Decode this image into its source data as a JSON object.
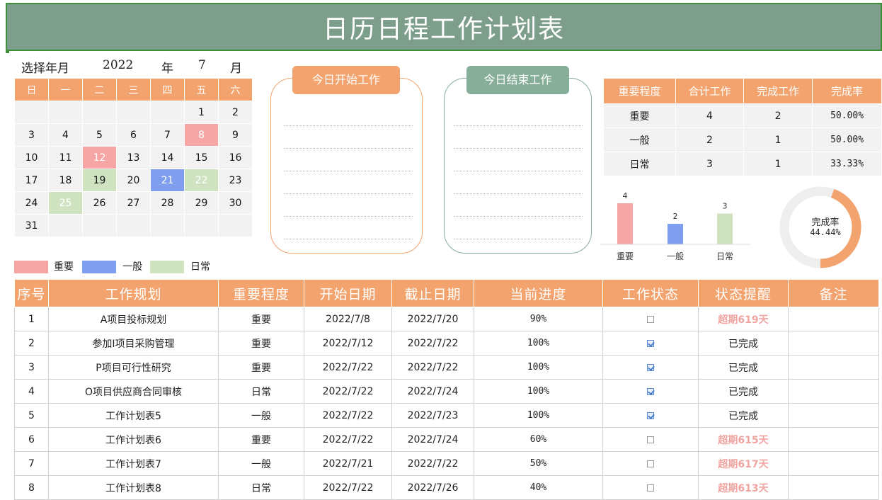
{
  "title": "日历日程工作计划表",
  "month_selector": {
    "label": "选择年月",
    "year": "2022",
    "year_unit": "年",
    "month": "7",
    "month_unit": "月"
  },
  "calendar": {
    "weekdays": [
      "日",
      "一",
      "二",
      "三",
      "四",
      "五",
      "六"
    ],
    "weeks": [
      [
        {
          "d": ""
        },
        {
          "d": ""
        },
        {
          "d": ""
        },
        {
          "d": ""
        },
        {
          "d": ""
        },
        {
          "d": "1"
        },
        {
          "d": "2"
        }
      ],
      [
        {
          "d": "3"
        },
        {
          "d": "4"
        },
        {
          "d": "5"
        },
        {
          "d": "6"
        },
        {
          "d": "7"
        },
        {
          "d": "8",
          "t": "imp"
        },
        {
          "d": "9"
        }
      ],
      [
        {
          "d": "10"
        },
        {
          "d": "11"
        },
        {
          "d": "12",
          "t": "imp"
        },
        {
          "d": "13"
        },
        {
          "d": "14"
        },
        {
          "d": "15"
        },
        {
          "d": "16"
        }
      ],
      [
        {
          "d": "17"
        },
        {
          "d": "18"
        },
        {
          "d": "19",
          "t": "day"
        },
        {
          "d": "20"
        },
        {
          "d": "21",
          "t": "gen"
        },
        {
          "d": "22",
          "t": "day light"
        },
        {
          "d": "23"
        }
      ],
      [
        {
          "d": "24"
        },
        {
          "d": "25",
          "t": "day light"
        },
        {
          "d": "26"
        },
        {
          "d": "27"
        },
        {
          "d": "28"
        },
        {
          "d": "29"
        },
        {
          "d": "30"
        }
      ],
      [
        {
          "d": "31"
        },
        {
          "d": ""
        },
        {
          "d": ""
        },
        {
          "d": ""
        },
        {
          "d": ""
        },
        {
          "d": ""
        },
        {
          "d": ""
        }
      ]
    ]
  },
  "legend": [
    {
      "label": "重要",
      "color": "#f7a6a6"
    },
    {
      "label": "一般",
      "color": "#7f9ef0"
    },
    {
      "label": "日常",
      "color": "#cfe3c0"
    }
  ],
  "panels": {
    "start": {
      "label": "今日开始工作",
      "color": "#f2a36e"
    },
    "end": {
      "label": "今日结束工作",
      "color": "#86ae99"
    }
  },
  "stats": {
    "headers": [
      "重要程度",
      "合计工作",
      "完成工作",
      "完成率"
    ],
    "rows": [
      [
        "重要",
        "4",
        "2",
        "50.00%"
      ],
      [
        "一般",
        "2",
        "1",
        "50.00%"
      ],
      [
        "日常",
        "3",
        "1",
        "33.33%"
      ]
    ]
  },
  "bar_chart": {
    "categories": [
      "重要",
      "一般",
      "日常"
    ],
    "values": [
      4,
      2,
      3
    ],
    "colors": [
      "#f7a6a6",
      "#7f9ef0",
      "#cfe3c0"
    ],
    "ymax": 4
  },
  "donut": {
    "label": "完成率",
    "value_text": "44.44%",
    "fraction": 0.4444,
    "color": "#f2a36e",
    "track": "#eeeeee"
  },
  "main_table": {
    "headers": [
      "序号",
      "工作规划",
      "重要程度",
      "开始日期",
      "截止日期",
      "当前进度",
      "工作状态",
      "状态提醒",
      "备注"
    ],
    "rows": [
      {
        "no": "1",
        "plan": "A项目投标规划",
        "level": "重要",
        "start": "2022/7/8",
        "end": "2022/7/20",
        "progress": "90%",
        "done": false,
        "status": "超期619天",
        "overdue": true,
        "note": ""
      },
      {
        "no": "2",
        "plan": "参加I项目采购管理",
        "level": "重要",
        "start": "2022/7/12",
        "end": "2022/7/22",
        "progress": "100%",
        "done": true,
        "status": "已完成",
        "overdue": false,
        "note": ""
      },
      {
        "no": "3",
        "plan": "P项目可行性研究",
        "level": "重要",
        "start": "2022/7/22",
        "end": "2022/7/22",
        "progress": "100%",
        "done": true,
        "status": "已完成",
        "overdue": false,
        "note": ""
      },
      {
        "no": "4",
        "plan": "O项目供应商合同审核",
        "level": "日常",
        "start": "2022/7/22",
        "end": "2022/7/24",
        "progress": "100%",
        "done": true,
        "status": "已完成",
        "overdue": false,
        "note": ""
      },
      {
        "no": "5",
        "plan": "工作计划表5",
        "level": "一般",
        "start": "2022/7/22",
        "end": "2022/7/23",
        "progress": "100%",
        "done": true,
        "status": "已完成",
        "overdue": false,
        "note": ""
      },
      {
        "no": "6",
        "plan": "工作计划表6",
        "level": "重要",
        "start": "2022/7/22",
        "end": "2022/7/24",
        "progress": "60%",
        "done": false,
        "status": "超期615天",
        "overdue": true,
        "note": ""
      },
      {
        "no": "7",
        "plan": "工作计划表7",
        "level": "一般",
        "start": "2022/7/21",
        "end": "2022/7/22",
        "progress": "50%",
        "done": false,
        "status": "超期617天",
        "overdue": true,
        "note": ""
      },
      {
        "no": "8",
        "plan": "工作计划表8",
        "level": "日常",
        "start": "2022/7/22",
        "end": "2022/7/26",
        "progress": "40%",
        "done": false,
        "status": "超期613天",
        "overdue": true,
        "note": ""
      }
    ]
  }
}
